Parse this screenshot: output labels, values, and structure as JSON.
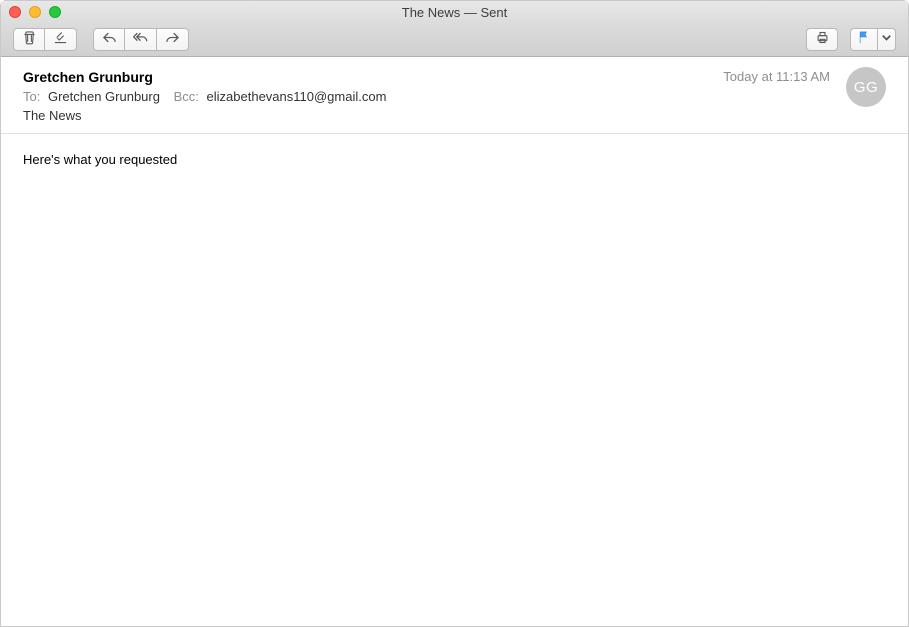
{
  "window": {
    "title": "The News — Sent"
  },
  "header": {
    "from": "Gretchen Grunburg",
    "to_label": "To:",
    "to": "Gretchen Grunburg",
    "bcc_label": "Bcc:",
    "bcc": "elizabethevans110@gmail.com",
    "subject": "The News",
    "timestamp": "Today at 11:13 AM",
    "avatar_initials": "GG"
  },
  "body": {
    "content": "Here's what you requested"
  },
  "icons": {
    "trash": "trash-icon",
    "junk": "junk-icon",
    "reply": "reply-icon",
    "reply_all": "reply-all-icon",
    "forward": "forward-icon",
    "print": "print-icon",
    "flag": "flag-icon",
    "dropdown": "chevron-down-icon"
  }
}
